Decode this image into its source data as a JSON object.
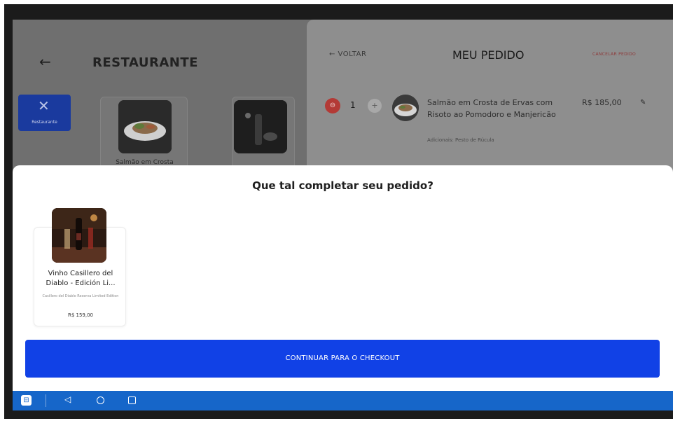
{
  "background_app": {
    "back_icon": "arrow-left-icon",
    "title": "RESTAURANTE",
    "category": {
      "icon": "fork-knife-icon",
      "label": "Restaurante"
    },
    "menu_item_label": "Salmão em Crosta"
  },
  "order_panel": {
    "back_label": "← VOLTAR",
    "title": "MEU PEDIDO",
    "cancel_label": "CANCELAR PEDIDO",
    "item": {
      "quantity": "1",
      "name": "Salmão em Crosta de Ervas com Risoto ao Pomodoro e Manjericão",
      "extras": "Adicionais: Pesto de Rúcula",
      "price": "R$ 185,00",
      "minus_icon": "minus-icon",
      "plus_icon": "plus-icon",
      "edit_icon": "edit-icon"
    }
  },
  "upsell": {
    "title": "Que tal completar seu pedido?",
    "product": {
      "name": "Vinho Casillero del Diablo - Edición Li...",
      "description": "Casillero del Diablo Reserva Limited Edition",
      "price": "R$ 159,00"
    },
    "checkout_button": "CONTINUAR PARA O CHECKOUT"
  },
  "navbar": {
    "app_icon": "app-switch-icon",
    "back_icon": "triangle-back-icon",
    "home_icon": "circle-home-icon",
    "recent_icon": "square-recents-icon"
  },
  "colors": {
    "accent": "#1141e6",
    "navbar": "#1666c9",
    "category_bg": "#1a3a9e",
    "danger": "#b33a36"
  }
}
